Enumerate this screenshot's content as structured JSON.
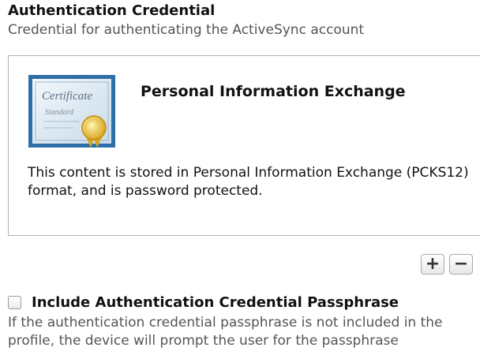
{
  "auth_section": {
    "title": "Authentication Credential",
    "description": "Credential for authenticating the ActiveSync account"
  },
  "credential": {
    "certificate_icon_text_top": "Certificate",
    "certificate_icon_text_bottom": "Standard",
    "name": "Personal Information Exchange",
    "info": "This content is stored in Personal Information Exchange (PCKS12) format, and is password protected."
  },
  "buttons": {
    "add_label": "+",
    "remove_label": "−"
  },
  "passphrase_option": {
    "checked": false,
    "label": "Include Authentication Credential Passphrase",
    "help": "If the authentication credential passphrase is not included in the profile, the device will prompt the user for the passphrase"
  }
}
